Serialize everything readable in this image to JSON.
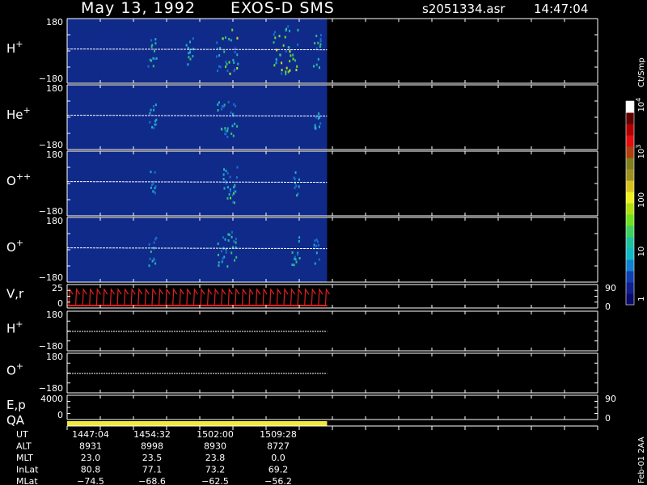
{
  "header": {
    "date": "May 13, 1992",
    "instrument": "EXOS-D SMS",
    "file": "s2051334.asr",
    "time": "14:47:04"
  },
  "colors": {
    "background": "#000000",
    "spectrogram_bg": "#102a8a",
    "velocity_trace": "#e02020",
    "qa_bar": "#f0ea3a",
    "axis": "#ffffff"
  },
  "chart_data": [
    {
      "type": "heatmap",
      "panel": "H+",
      "label": "H",
      "label_sup": "+",
      "ylim": [
        -180,
        180
      ],
      "y_ticks": [
        "180",
        "−180"
      ],
      "data_extent_fraction": 0.49,
      "bursts": [
        {
          "x_fraction": 0.16,
          "intensity": 0.5
        },
        {
          "x_fraction": 0.23,
          "intensity": 0.4
        },
        {
          "x_fraction": 0.29,
          "intensity": 0.6
        },
        {
          "x_fraction": 0.31,
          "intensity": 0.8
        },
        {
          "x_fraction": 0.4,
          "intensity": 0.9
        },
        {
          "x_fraction": 0.42,
          "intensity": 1.0
        },
        {
          "x_fraction": 0.47,
          "intensity": 0.5
        }
      ]
    },
    {
      "type": "heatmap",
      "panel": "He+",
      "label": "He",
      "label_sup": "+",
      "ylim": [
        -180,
        180
      ],
      "y_ticks": [
        "180",
        "−180"
      ],
      "data_extent_fraction": 0.49,
      "bursts": [
        {
          "x_fraction": 0.16,
          "intensity": 0.4
        },
        {
          "x_fraction": 0.29,
          "intensity": 0.5
        },
        {
          "x_fraction": 0.31,
          "intensity": 0.6
        },
        {
          "x_fraction": 0.47,
          "intensity": 0.3
        }
      ]
    },
    {
      "type": "heatmap",
      "panel": "O++",
      "label": "O",
      "label_sup": "++",
      "ylim": [
        -180,
        180
      ],
      "y_ticks": [
        "180",
        "−180"
      ],
      "data_extent_fraction": 0.49,
      "bursts": [
        {
          "x_fraction": 0.16,
          "intensity": 0.3
        },
        {
          "x_fraction": 0.3,
          "intensity": 0.5
        },
        {
          "x_fraction": 0.31,
          "intensity": 0.6
        },
        {
          "x_fraction": 0.43,
          "intensity": 0.3
        }
      ]
    },
    {
      "type": "heatmap",
      "panel": "O+",
      "label": "O",
      "label_sup": "+",
      "ylim": [
        -180,
        180
      ],
      "y_ticks": [
        "180",
        "−180"
      ],
      "data_extent_fraction": 0.49,
      "bursts": [
        {
          "x_fraction": 0.16,
          "intensity": 0.4
        },
        {
          "x_fraction": 0.29,
          "intensity": 0.5
        },
        {
          "x_fraction": 0.31,
          "intensity": 0.6
        },
        {
          "x_fraction": 0.43,
          "intensity": 0.4
        },
        {
          "x_fraction": 0.47,
          "intensity": 0.3
        }
      ]
    },
    {
      "type": "line",
      "panel": "V,r",
      "label": "V,r",
      "ylim": [
        0,
        25
      ],
      "y_ticks": [
        "25",
        "0"
      ],
      "right_ticks": [
        "90",
        "0"
      ],
      "data_extent_fraction": 0.49,
      "spikes": 38
    },
    {
      "type": "scatter",
      "panel": "H+ angle",
      "label": "H",
      "label_sup": "+",
      "ylim": [
        -180,
        180
      ],
      "y_ticks": [
        "180",
        "−180"
      ],
      "data_extent_fraction": 0.49,
      "trace_value": -4
    },
    {
      "type": "scatter",
      "panel": "O+ angle",
      "label": "O",
      "label_sup": "+",
      "ylim": [
        -180,
        180
      ],
      "y_ticks": [
        "180",
        "−180"
      ],
      "data_extent_fraction": 0.49,
      "trace_value": -4
    },
    {
      "type": "line",
      "panel": "E,p",
      "label": "E,p",
      "ylim": [
        0,
        4000
      ],
      "y_ticks": [
        "4000",
        "0"
      ],
      "right_ticks": [
        "90",
        "0"
      ],
      "data_extent_fraction": 0.49
    }
  ],
  "qa": {
    "label": "QA",
    "coverage_fraction": 0.49
  },
  "colorbar": {
    "title": "Ct/Smp",
    "ticks": [
      {
        "text": "1",
        "pos": 0.04
      },
      {
        "text": "10",
        "pos": 0.26
      },
      {
        "text": "100",
        "pos": 0.5
      },
      {
        "text": "10",
        "sup": "3",
        "pos": 0.74
      },
      {
        "text": "10",
        "sup": "4",
        "pos": 0.97
      }
    ],
    "colors": [
      "#0a0a6a",
      "#10208a",
      "#1040b0",
      "#1080d0",
      "#10b8c8",
      "#20c0a0",
      "#40d060",
      "#70e020",
      "#b0e010",
      "#f0f020",
      "#d8c020",
      "#a09020",
      "#808020",
      "#b04010",
      "#e01010",
      "#b00000",
      "#600000",
      "#ffffff"
    ]
  },
  "footer": {
    "rows": [
      {
        "name": "UT",
        "values": [
          "1447:04",
          "1454:32",
          "1502:00",
          "1509:28"
        ]
      },
      {
        "name": "ALT",
        "values": [
          "8931",
          "8998",
          "8930",
          "8727"
        ]
      },
      {
        "name": "MLT",
        "values": [
          "23.0",
          "23.5",
          "23.8",
          "0.0"
        ]
      },
      {
        "name": "InLat",
        "values": [
          "80.8",
          "77.1",
          "73.2",
          "69.2"
        ]
      },
      {
        "name": "MLat",
        "values": [
          "−74.5",
          "−68.6",
          "−62.5",
          "−56.2"
        ]
      }
    ]
  },
  "side_note": "Feb-01 2AA"
}
